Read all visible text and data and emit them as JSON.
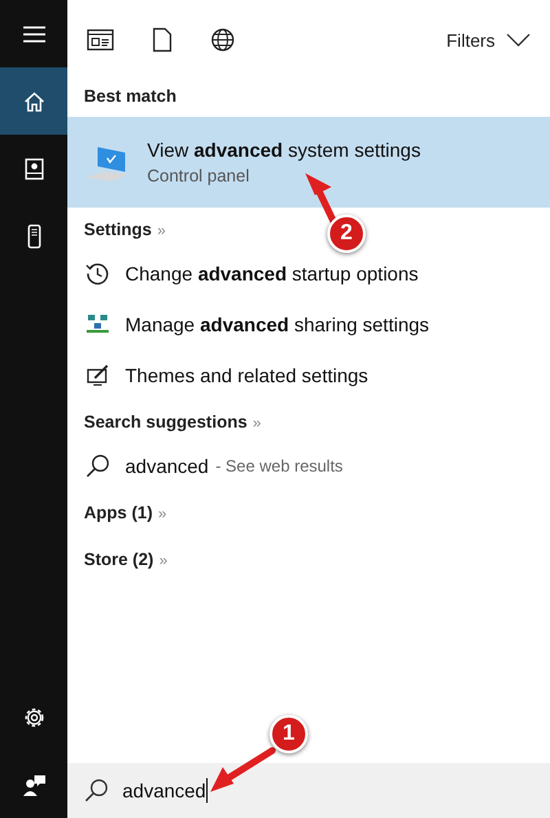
{
  "sidebar": {
    "items": [
      {
        "kind": "menu",
        "selected": false
      },
      {
        "kind": "home",
        "selected": true
      },
      {
        "kind": "notebook",
        "selected": false
      },
      {
        "kind": "device",
        "selected": false
      }
    ],
    "bottom_items": [
      {
        "kind": "settings"
      },
      {
        "kind": "feedback"
      }
    ]
  },
  "toolbar": {
    "filters": "Filters"
  },
  "best_match": {
    "header": "Best match",
    "title": "View **advanced** system settings",
    "subtitle": "Control panel",
    "selected": true
  },
  "settings": {
    "header": "Settings",
    "more": "»",
    "items": [
      {
        "kind": "history",
        "label": "Change **advanced** startup options"
      },
      {
        "kind": "network",
        "label": "Manage **advanced** sharing settings"
      },
      {
        "kind": "themes",
        "label": "Themes and related settings"
      }
    ]
  },
  "search_suggestions": {
    "header": "Search suggestions",
    "more": "»",
    "items": [
      {
        "query": "advanced",
        "hint": "- See web results"
      }
    ]
  },
  "categories": [
    {
      "label": "Apps (1)",
      "more": "»"
    },
    {
      "label": "Store (2)",
      "more": "»"
    }
  ],
  "search_box": {
    "value": "advanced"
  },
  "annotations": [
    {
      "number": "2"
    },
    {
      "number": "1"
    }
  ]
}
